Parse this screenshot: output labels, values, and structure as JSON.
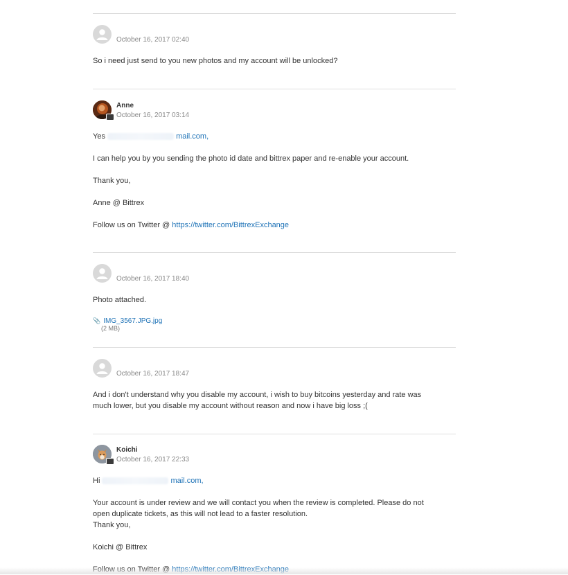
{
  "comments": [
    {
      "author": "",
      "date": "October 16, 2017 02:40",
      "lines": [
        "So i need just send to you new photos and my account will be unlocked?"
      ]
    },
    {
      "author": "Anne",
      "date": "October 16, 2017 03:14",
      "greeting": "Yes",
      "email_suffix": "mail.com,",
      "lines": [
        "I can help you by you sending the photo id date and bittrex paper and re-enable your account.",
        "Thank you,",
        "Anne @ Bittrex"
      ],
      "follow_text": "Follow us on Twitter @",
      "follow_link": "https://twitter.com/BittrexExchange"
    },
    {
      "author": "",
      "date": "October 16, 2017 18:40",
      "lines": [
        "Photo attached."
      ],
      "attachment": {
        "name": "IMG_3567.JPG.jpg",
        "size": "(2 MB)",
        "icon": "paperclip-icon"
      }
    },
    {
      "author": "",
      "date": "October 16, 2017 18:47",
      "lines": [
        "And i don't understand why you disable my account, i wish to buy bitcoins yesterday and rate was",
        "much lower, but you disable my account without reason and now i have big loss ;("
      ]
    },
    {
      "author": "Koichi",
      "date": "October 16, 2017 22:33",
      "greeting": "Hi",
      "email_suffix": "mail.com,",
      "lines": [
        "Your account is under review and we will contact you when the review is completed. Please do not",
        "open duplicate tickets, as this will not lead to a faster resolution.",
        "Thank you,",
        "Koichi @ Bittrex"
      ],
      "follow_text": "Follow us on Twitter @",
      "follow_link": "https://twitter.com/BittrexExchange"
    }
  ],
  "icons": {
    "default_avatar": "user-avatar-icon",
    "attachment": "paperclip-icon"
  },
  "colors": {
    "link": "#1f73b7",
    "divider": "#dddddd",
    "meta": "#888888",
    "text": "#333333"
  }
}
